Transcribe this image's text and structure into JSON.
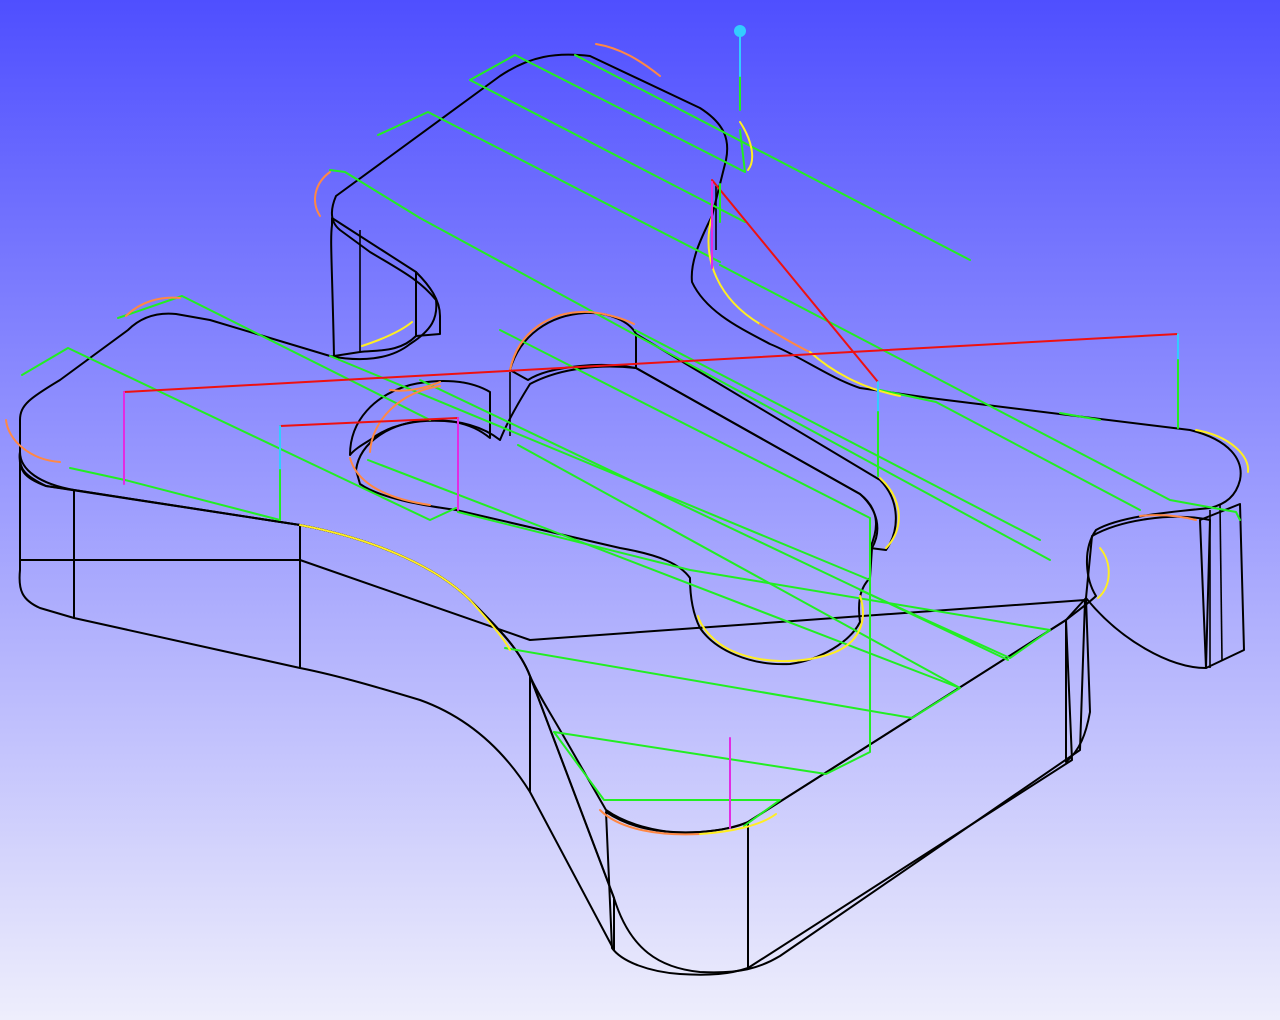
{
  "viewport": {
    "background": {
      "top": "#4f4fff",
      "bottom": "#eeeefc"
    },
    "colors": {
      "top_face": "#8a8a8a",
      "edge": "#000000",
      "cut_feed": "#22ee22",
      "rapid_move": "#ee1111",
      "plunge": "#e22ce2",
      "retract": "#33ccff",
      "arc_cw": "#ffee22",
      "arc_ccw": "#ff8844",
      "start_marker": "#33ccff"
    }
  }
}
